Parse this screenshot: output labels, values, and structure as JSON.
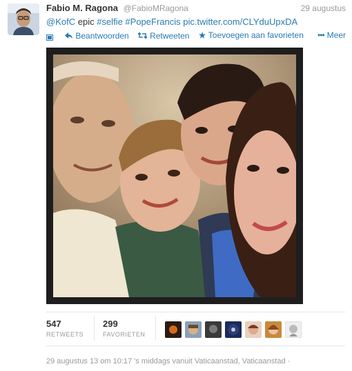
{
  "tweet": {
    "author_name": "Fabio M. Ragona",
    "author_handle": "@FabioMRagona",
    "date": "29 augustus",
    "mention": "@KofC",
    "text_plain": "epic",
    "hashtag1": "#selfie",
    "hashtag2": "#PopeFrancis",
    "link": "pic.twitter.com/CLYduUpxDA"
  },
  "actions": {
    "reply": "Beantwoorden",
    "retweet": "Retweeten",
    "favorite": "Toevoegen aan favorieten",
    "more": "Meer"
  },
  "stats": {
    "retweets_count": "547",
    "retweets_label": "RETWEETS",
    "favorites_count": "299",
    "favorites_label": "FAVORIETEN"
  },
  "footer": {
    "timestamp": "29 augustus 13 om 10:17 's middags vanuit Vaticaanstad, Vaticaanstad ·"
  },
  "colors": {
    "link": "#2a7ab5",
    "muted": "#999999",
    "text": "#333333"
  }
}
